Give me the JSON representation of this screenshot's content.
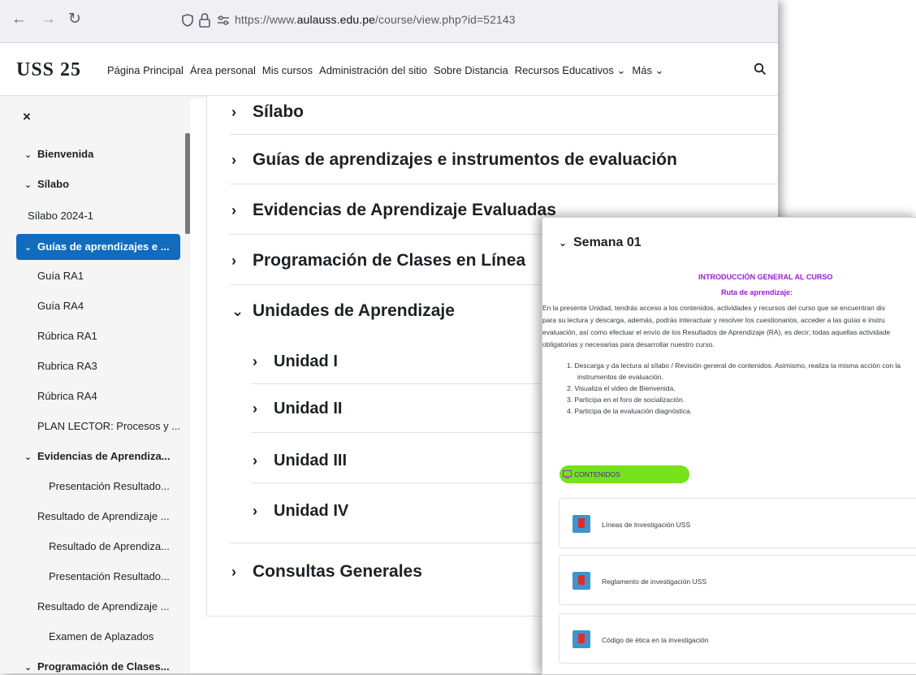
{
  "browser": {
    "url_prefix": "https://www.",
    "url_domain": "aulauss.edu.pe",
    "url_path": "/course/view.php?id=52143"
  },
  "navbar": {
    "logo": "USS 25",
    "menu": [
      "Página Principal",
      "Área personal",
      "Mis cursos",
      "Administración del sitio",
      "Sobre Distancia",
      "Recursos Educativos ⌄",
      "Más ⌄"
    ]
  },
  "sidebar": {
    "close": "×",
    "items": [
      {
        "label": "Bienvenida",
        "chev": "⌄"
      },
      {
        "label": "Sílabo",
        "chev": "⌄"
      },
      {
        "label": "Sílabo 2024-1"
      },
      {
        "label": "Guías de aprendizajes e ...",
        "chev": "⌄"
      },
      {
        "label": "Guía RA1"
      },
      {
        "label": "Guía RA4"
      },
      {
        "label": "Rúbrica RA1"
      },
      {
        "label": "Rubrica RA3"
      },
      {
        "label": "Rúbrica RA4"
      },
      {
        "label": "PLAN LECTOR: Procesos y ..."
      },
      {
        "label": "Evidencias de Aprendiza...",
        "chev": "⌄"
      },
      {
        "label": "Presentación Resultado..."
      },
      {
        "label": "Resultado de Aprendizaje ..."
      },
      {
        "label": "Resultado de Aprendiza..."
      },
      {
        "label": "Presentación Resultado..."
      },
      {
        "label": "Resultado de Aprendizaje ..."
      },
      {
        "label": "Examen de Aplazados"
      },
      {
        "label": "Programación de Clases...",
        "chev": "⌄"
      }
    ]
  },
  "sections": [
    {
      "label": "Sílabo",
      "chev": "›"
    },
    {
      "label": "Guías de aprendizajes e instrumentos de evaluación",
      "chev": "›"
    },
    {
      "label": "Evidencias de Aprendizaje Evaluadas",
      "chev": "›"
    },
    {
      "label": "Programación de Clases en Línea",
      "chev": "›"
    },
    {
      "label": "Unidades de Aprendizaje",
      "chev": "⌄"
    },
    {
      "label": "Unidad I",
      "chev": "›"
    },
    {
      "label": "Unidad II",
      "chev": "›"
    },
    {
      "label": "Unidad III",
      "chev": "›"
    },
    {
      "label": "Unidad IV",
      "chev": "›"
    },
    {
      "label": "Consultas Generales",
      "chev": "›"
    }
  ],
  "panel": {
    "title": "Semana 01",
    "chev": "⌄",
    "heading1": "INTRODUCCIÓN GENERAL AL CURSO",
    "heading2": "Ruta de aprendizaje:",
    "para": [
      "En la presente Unidad, tendrás acceso a los contenidos, actividades y recursos del curso que se encuentran dis",
      "para su lectura y descarga, además, podrás interactuar y resolver los cuestionarios, acceder a las guías e instru",
      "evaluación, así como efectuar el envío de los Resultados de Aprendizaje (RA), es decir; todas aquellas actividade",
      "obligatorias y necesarias para desarrollar nuestro curso."
    ],
    "steps": [
      "1. Descarga y da lectura al sílabo / Revisión general de contenidos. Asimismo, realiza la misma acción con la",
      "instrumentos de evaluación.",
      "2. Visualiza el video de Bienvenida.",
      "3. Participa en el foro de socialización.",
      "4. Participa de la evaluación diagnóstica."
    ],
    "contents_label": "CONTENIDOS",
    "resources": [
      "Líneas de Investigación USS",
      "Reglamento de investigación USS",
      "Código de ética en la investigación"
    ]
  }
}
